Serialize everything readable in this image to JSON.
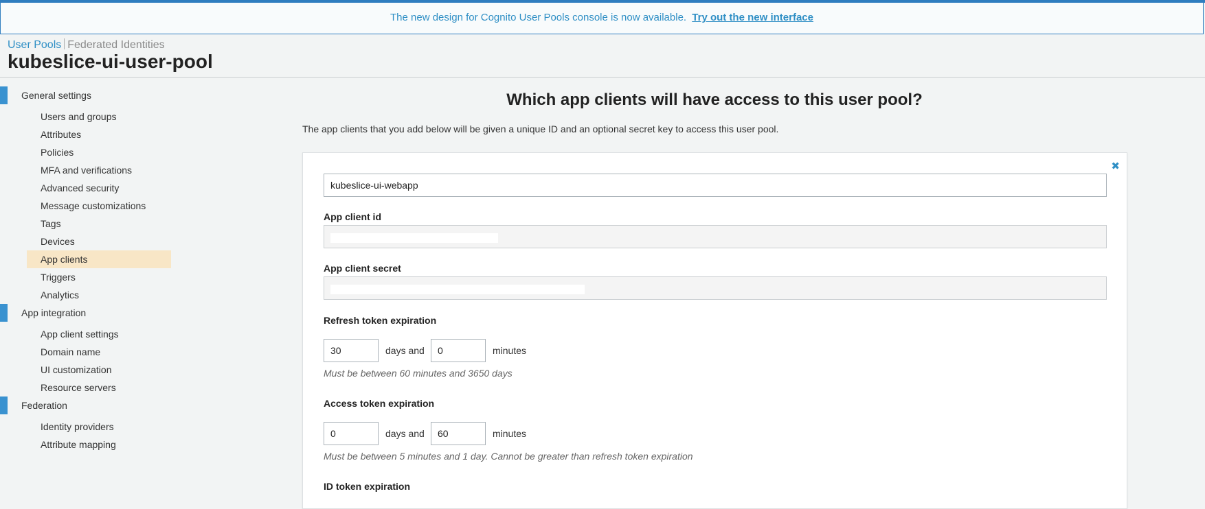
{
  "banner": {
    "text": "The new design for Cognito User Pools console is now available.",
    "link": "Try out the new interface"
  },
  "breadcrumb": {
    "active": "User Pools",
    "inactive": "Federated Identities"
  },
  "pool_name": "kubeslice-ui-user-pool",
  "sidebar": {
    "general": {
      "label": "General settings",
      "items": [
        "Users and groups",
        "Attributes",
        "Policies",
        "MFA and verifications",
        "Advanced security",
        "Message customizations",
        "Tags",
        "Devices",
        "App clients",
        "Triggers",
        "Analytics"
      ]
    },
    "app_integration": {
      "label": "App integration",
      "items": [
        "App client settings",
        "Domain name",
        "UI customization",
        "Resource servers"
      ]
    },
    "federation": {
      "label": "Federation",
      "items": [
        "Identity providers",
        "Attribute mapping"
      ]
    },
    "selected": "App clients"
  },
  "main": {
    "title": "Which app clients will have access to this user pool?",
    "description": "The app clients that you add below will be given a unique ID and an optional secret key to access this user pool."
  },
  "client": {
    "name": "kubeslice-ui-webapp",
    "id_label": "App client id",
    "secret_label": "App client secret",
    "refresh_label": "Refresh token expiration",
    "refresh_days": "30",
    "refresh_minutes": "0",
    "days_and": "days and",
    "minutes": "minutes",
    "refresh_hint": "Must be between 60 minutes and 3650 days",
    "access_label": "Access token expiration",
    "access_days": "0",
    "access_minutes": "60",
    "access_hint": "Must be between 5 minutes and 1 day. Cannot be greater than refresh token expiration",
    "id_token_label": "ID token expiration",
    "close_glyph": "✖"
  },
  "colors": {
    "accent": "#2f8fc5",
    "sidebar_bar": "#3a92d0",
    "selected_bg": "#f8e6c6"
  }
}
